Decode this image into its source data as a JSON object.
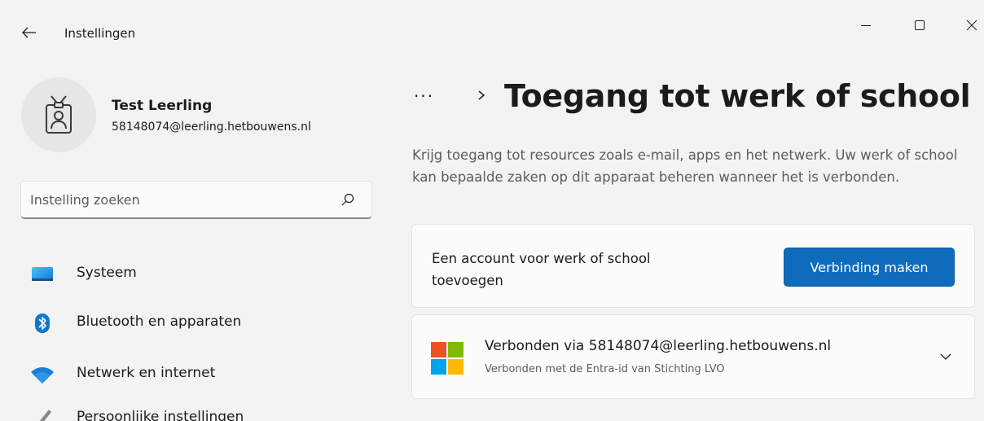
{
  "window": {
    "title": "Instellingen"
  },
  "profile": {
    "name": "Test Leerling",
    "email": "58148074@leerling.hetbouwens.nl"
  },
  "search": {
    "placeholder": "Instelling zoeken"
  },
  "sidebar": {
    "items": [
      {
        "label": "Systeem",
        "icon": "monitor-icon"
      },
      {
        "label": "Bluetooth en apparaten",
        "icon": "bluetooth-icon"
      },
      {
        "label": "Netwerk en internet",
        "icon": "wifi-icon"
      },
      {
        "label": "Persoonlijke instellingen",
        "icon": "brush-icon"
      }
    ]
  },
  "breadcrumb": {
    "more": "···",
    "title": "Toegang tot werk of school"
  },
  "main": {
    "description": "Krijg toegang tot resources zoals e-mail, apps en het netwerk. Uw werk of school kan bepaalde zaken op dit apparaat beheren wanneer het is verbonden.",
    "add_account": {
      "label": "Een account voor werk of school toevoegen",
      "button": "Verbinding maken"
    },
    "connected_account": {
      "title": "Verbonden via 58148074@leerling.hetbouwens.nl",
      "subtitle": "Verbonden met de Entra-id van Stichting LVO",
      "icon": "microsoft-logo"
    }
  },
  "colors": {
    "accent": "#0f6cbd",
    "background": "#f3f3f3",
    "card": "#fbfbfb",
    "ms_red": "#f25022",
    "ms_green": "#7fba00",
    "ms_blue": "#00a4ef",
    "ms_yellow": "#ffb900"
  }
}
